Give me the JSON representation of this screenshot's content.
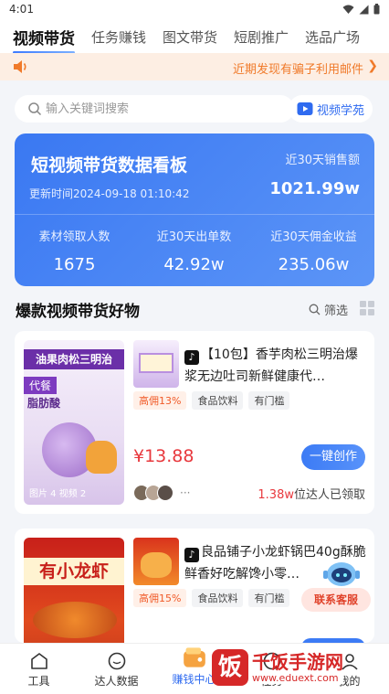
{
  "status_bar": {
    "time": "4:01"
  },
  "tabs": [
    {
      "label": "视频带货",
      "active": true
    },
    {
      "label": "任务赚钱"
    },
    {
      "label": "图文带货"
    },
    {
      "label": "短剧推广"
    },
    {
      "label": "选品广场"
    }
  ],
  "notice": {
    "text": "近期发现有骗子利用邮件"
  },
  "search": {
    "placeholder": "输入关键词搜索",
    "value": ""
  },
  "video_academy": {
    "label": "视频学苑"
  },
  "dashboard": {
    "title": "短视频带货数据看板",
    "updated": "更新时间2024-09-18 01:10:42",
    "sales_label": "近30天销售额",
    "sales_value": "1021.99w",
    "stats": [
      {
        "label": "素材领取人数",
        "value": "1675"
      },
      {
        "label": "近30天出单数",
        "value": "42.92w"
      },
      {
        "label": "近30天佣金收益",
        "value": "235.06w"
      }
    ]
  },
  "section": {
    "title": "爆款视频带货好物",
    "filter_label": "筛选"
  },
  "products": [
    {
      "title": "【10包】香芋肉松三明治爆浆无边吐司新鲜健康代…",
      "tags": [
        "高佣13%",
        "食品饮料",
        "有门槛"
      ],
      "price": "¥13.88",
      "button": "一键创作",
      "avatars_more": "···",
      "claimed_count": "1.38w",
      "claimed_suffix": "位达人已领取",
      "thumb_banner": "油果肉松三明治",
      "thumb_sub1": "代餐",
      "thumb_sub2": "脂肪酸",
      "thumb_meta": "图片 4    视频 2"
    },
    {
      "title": "良品铺子小龙虾锅巴40g酥脆鲜香好吃解馋小零…",
      "tags": [
        "高佣15%",
        "食品饮料",
        "有门槛"
      ],
      "thumb_banner": "有小龙虾"
    }
  ],
  "customer_service": {
    "label": "联系客服"
  },
  "bottom_nav": [
    {
      "label": "工具"
    },
    {
      "label": "达人数据"
    },
    {
      "label": "赚钱中心",
      "active": true
    },
    {
      "label": "任务"
    },
    {
      "label": "我的"
    }
  ],
  "watermark": {
    "logo": "饭",
    "name": "千饭手游网",
    "url": "www.eduext.com"
  },
  "colors": {
    "accent": "#2f6bf0",
    "price": "#e8383d",
    "notice": "#f07a2a"
  }
}
